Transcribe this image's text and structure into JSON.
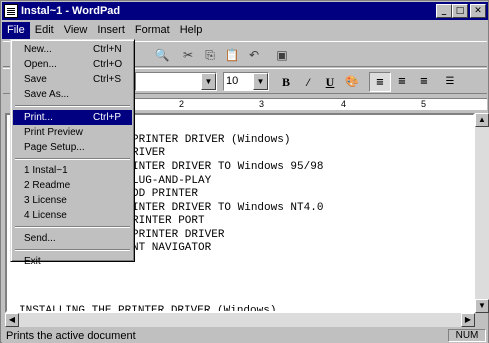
{
  "window": {
    "title": "Instal~1 - WordPad",
    "buttons": {
      "minimize": "_",
      "maximize": "□",
      "close": "✕"
    }
  },
  "menubar": [
    "File",
    "Edit",
    "View",
    "Insert",
    "Format",
    "Help"
  ],
  "file_menu": {
    "group1": [
      {
        "label": "New...",
        "shortcut": "Ctrl+N"
      },
      {
        "label": "Open...",
        "shortcut": "Ctrl+O"
      },
      {
        "label": "Save",
        "shortcut": "Ctrl+S"
      },
      {
        "label": "Save As...",
        "shortcut": ""
      }
    ],
    "group2": [
      {
        "label": "Print...",
        "shortcut": "Ctrl+P",
        "selected": true
      },
      {
        "label": "Print Preview",
        "shortcut": ""
      },
      {
        "label": "Page Setup...",
        "shortcut": ""
      }
    ],
    "group3": [
      {
        "label": "1 Instal~1",
        "shortcut": ""
      },
      {
        "label": "2 Readme",
        "shortcut": ""
      },
      {
        "label": "3 License",
        "shortcut": ""
      },
      {
        "label": "4 License",
        "shortcut": ""
      }
    ],
    "group4": [
      {
        "label": "Send...",
        "shortcut": ""
      }
    ],
    "group5": [
      {
        "label": "Exit",
        "shortcut": ""
      }
    ]
  },
  "format_bar": {
    "font_size": "10",
    "bold": "B",
    "italic": "/",
    "underline": "U"
  },
  "ruler": [
    "2",
    "3",
    "4",
    "5"
  ],
  "document": {
    "lines": [
      "PRINTER DRIVER (Windows)",
      "RIVER",
      "INTER DRIVER TO Windows 95/98",
      "LUG-AND-PLAY",
      "DD PRINTER",
      "INTER DRIVER TO Windows NT4.0",
      "RINTER PORT",
      "PRINTER DRIVER",
      "NT NAVIGATOR"
    ],
    "bottom_line": "INSTALLING THE PRINTER DRIVER (Windows)"
  },
  "status": {
    "text": "Prints the active document",
    "num": "NUM"
  }
}
